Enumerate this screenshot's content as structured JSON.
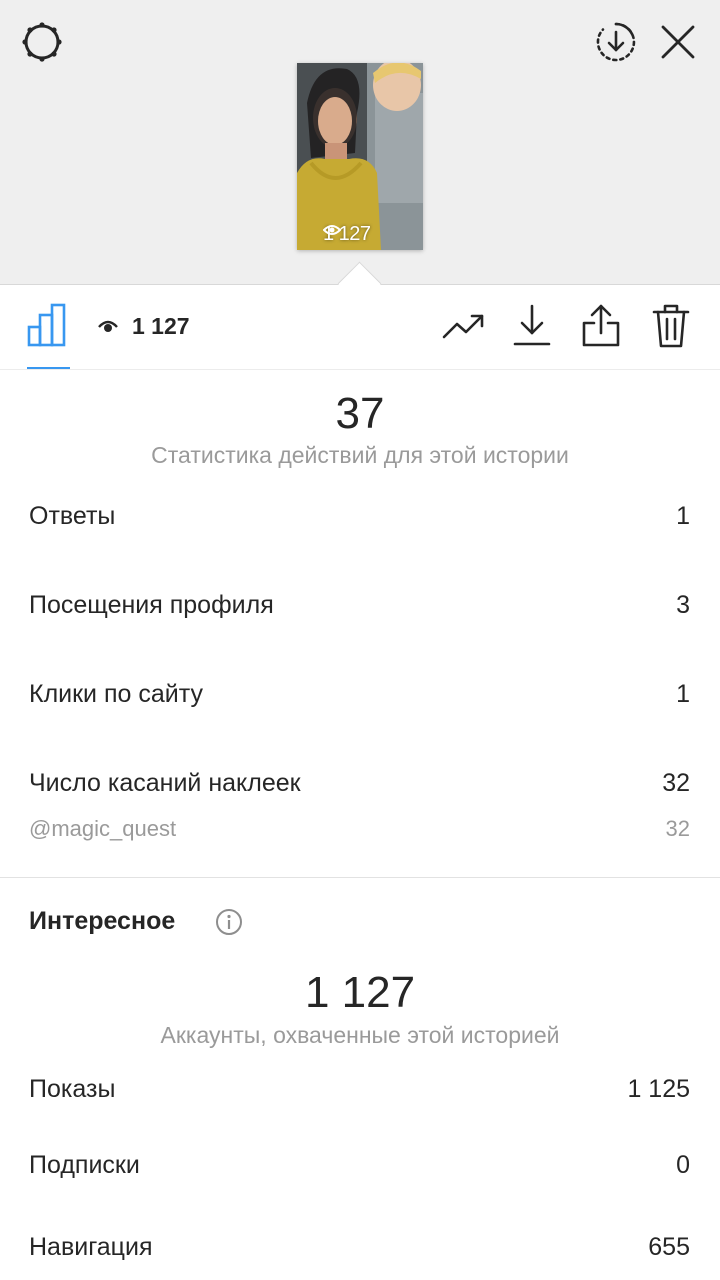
{
  "header": {
    "settings_icon": "gear-icon",
    "download_all_icon": "circle-download-icon",
    "close_icon": "close-icon"
  },
  "story_preview": {
    "view_count": "1 127",
    "eye_icon": "eye-icon"
  },
  "toolbar": {
    "insights_tab_icon": "bar-chart-icon",
    "eye_icon": "eye-icon",
    "views_count": "1 127",
    "actions": [
      {
        "name": "promote",
        "icon": "trending-up-icon"
      },
      {
        "name": "download",
        "icon": "download-icon"
      },
      {
        "name": "share",
        "icon": "share-icon"
      },
      {
        "name": "delete",
        "icon": "trash-icon"
      }
    ],
    "accent_color": "#3897f0"
  },
  "interactions": {
    "total": "37",
    "caption": "Статистика действий для этой истории",
    "rows": [
      {
        "label": "Ответы",
        "value": "1"
      },
      {
        "label": "Посещения профиля",
        "value": "3"
      },
      {
        "label": "Клики по сайту",
        "value": "1"
      },
      {
        "label": "Число касаний наклеек",
        "value": "32"
      }
    ],
    "sticker": {
      "label": "@magic_quest",
      "value": "32"
    }
  },
  "discovery": {
    "title": "Интересное",
    "info_icon": "info-icon",
    "total": "1 127",
    "caption": "Аккаунты, охваченные этой историей",
    "rows": [
      {
        "label": "Показы",
        "value": "1 125"
      },
      {
        "label": "Подписки",
        "value": "0"
      },
      {
        "label": "Навигация",
        "value": "655"
      }
    ]
  }
}
